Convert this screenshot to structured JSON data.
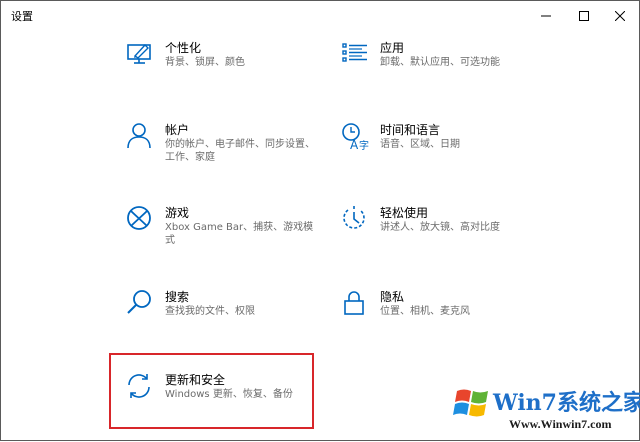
{
  "window": {
    "title": "设置"
  },
  "controls": {
    "minimize": "—",
    "maximize": "☐",
    "close": "✕"
  },
  "colors": {
    "accent": "#0067c0",
    "highlight": "#d8262a",
    "muted": "#6b6b6b"
  },
  "tiles": [
    {
      "title": "个性化",
      "desc": "背景、锁屏、颜色",
      "icon": "personalization-icon"
    },
    {
      "title": "应用",
      "desc": "卸载、默认应用、可选功能",
      "icon": "apps-icon"
    },
    {
      "title": "帐户",
      "desc": "你的帐户、电子邮件、同步设置、工作、家庭",
      "icon": "accounts-icon"
    },
    {
      "title": "时间和语言",
      "desc": "语音、区域、日期",
      "icon": "time-language-icon"
    },
    {
      "title": "游戏",
      "desc": "Xbox Game Bar、捕获、游戏模式",
      "icon": "xbox-icon"
    },
    {
      "title": "轻松使用",
      "desc": "讲述人、放大镜、高对比度",
      "icon": "ease-of-access-icon"
    },
    {
      "title": "搜索",
      "desc": "查找我的文件、权限",
      "icon": "search-icon"
    },
    {
      "title": "隐私",
      "desc": "位置、相机、麦克风",
      "icon": "lock-icon"
    },
    {
      "title": "更新和安全",
      "desc": "Windows 更新、恢复、备份",
      "icon": "update-sync-icon"
    }
  ],
  "watermark": {
    "text": "Win7系统之家",
    "url": "Www.Winwin7.com",
    "logo": "windows-logo-icon"
  }
}
